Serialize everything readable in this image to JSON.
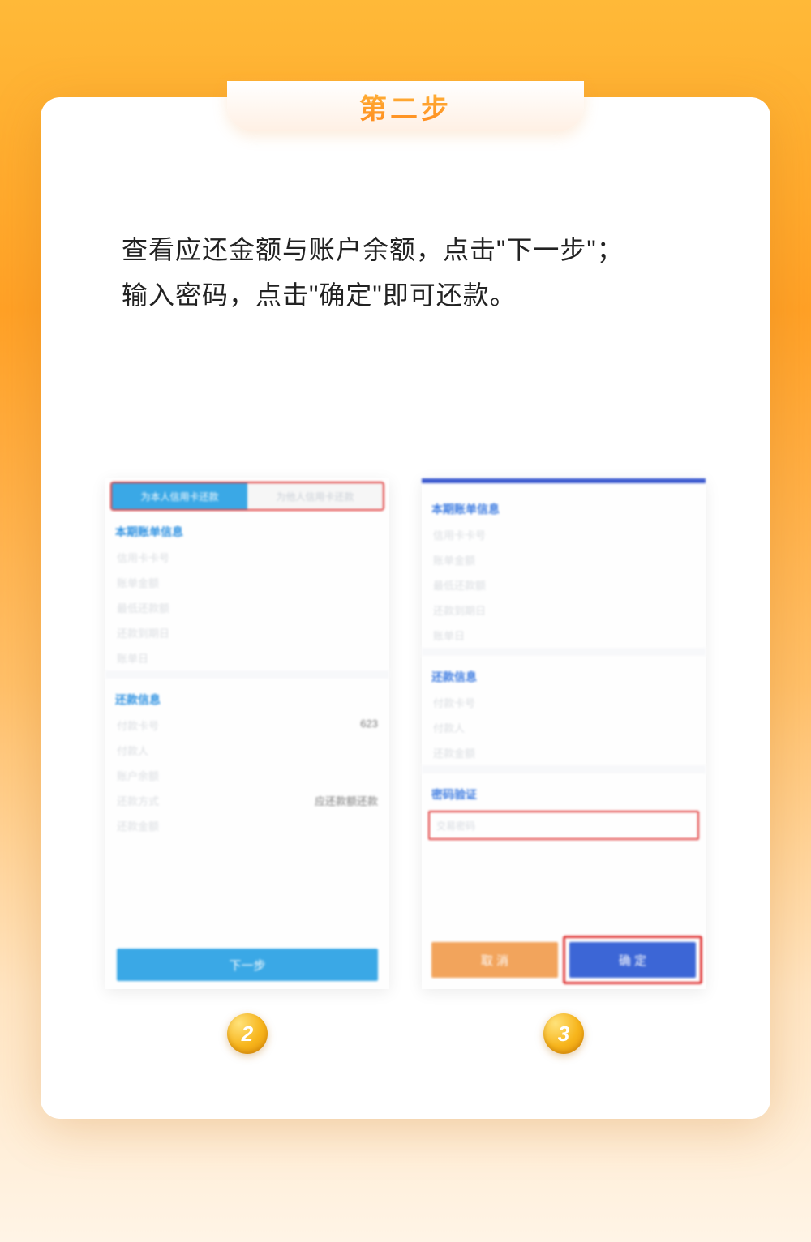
{
  "header": {
    "step_label": "第二步"
  },
  "instruction": {
    "line1": "查看应还金额与账户余额，点击\"下一步\"；",
    "line2": "输入密码，点击\"确定\"即可还款。"
  },
  "left_screenshot": {
    "tab_active": "为本人信用卡还款",
    "tab_inactive": "为他人信用卡还款",
    "section1_title": "本期账单信息",
    "rows1": {
      "r1": "信用卡卡号",
      "r2": "账单金额",
      "r3": "最低还款额",
      "r4": "还款到期日",
      "r5": "账单日"
    },
    "section2_title": "还款信息",
    "rows2": {
      "pay_card_label": "付款卡号",
      "pay_card_value": "623",
      "payer_label": "付款人",
      "balance_label": "账户余额",
      "method_label": "还款方式",
      "method_value": "应还款额还款",
      "amount_label": "还款金额"
    },
    "next_button": "下一步"
  },
  "right_screenshot": {
    "section1_title": "本期账单信息",
    "rows1": {
      "r1": "信用卡卡号",
      "r2": "账单金额",
      "r3": "最低还款额",
      "r4": "还款到期日",
      "r5": "账单日"
    },
    "section2_title": "还款信息",
    "rows2": {
      "pay_card_label": "付款卡号",
      "payer_label": "付款人",
      "amount_label": "还款金额"
    },
    "section3_title": "密码验证",
    "password_placeholder": "交易密码",
    "cancel_button": "取 消",
    "confirm_button": "确 定"
  },
  "badges": {
    "b2": "2",
    "b3": "3"
  }
}
